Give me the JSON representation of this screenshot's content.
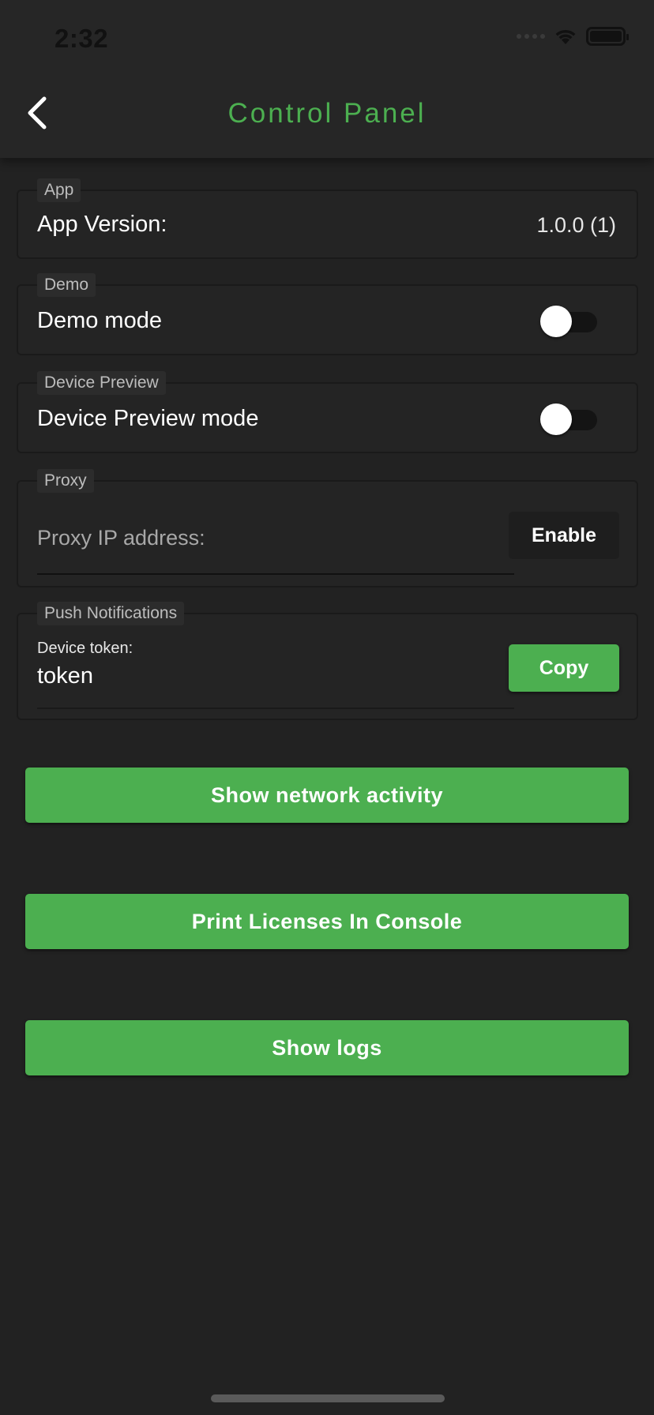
{
  "status_bar": {
    "time": "2:32"
  },
  "header": {
    "title": "Control Panel"
  },
  "sections": {
    "app": {
      "label": "App",
      "version_label": "App Version:",
      "version_value": "1.0.0 (1)"
    },
    "demo": {
      "label": "Demo",
      "toggle_label": "Demo mode",
      "enabled": false
    },
    "device_preview": {
      "label": "Device Preview",
      "toggle_label": "Device Preview mode",
      "enabled": false
    },
    "proxy": {
      "label": "Proxy",
      "input_placeholder": "Proxy IP address:",
      "enable_button": "Enable"
    },
    "push": {
      "label": "Push Notifications",
      "token_label": "Device token:",
      "token_value": "token",
      "copy_button": "Copy"
    }
  },
  "actions": {
    "network_activity": "Show network activity",
    "print_licenses": "Print Licenses In Console",
    "show_logs": "Show logs"
  },
  "colors": {
    "accent": "#4caf50",
    "background": "#222222"
  }
}
